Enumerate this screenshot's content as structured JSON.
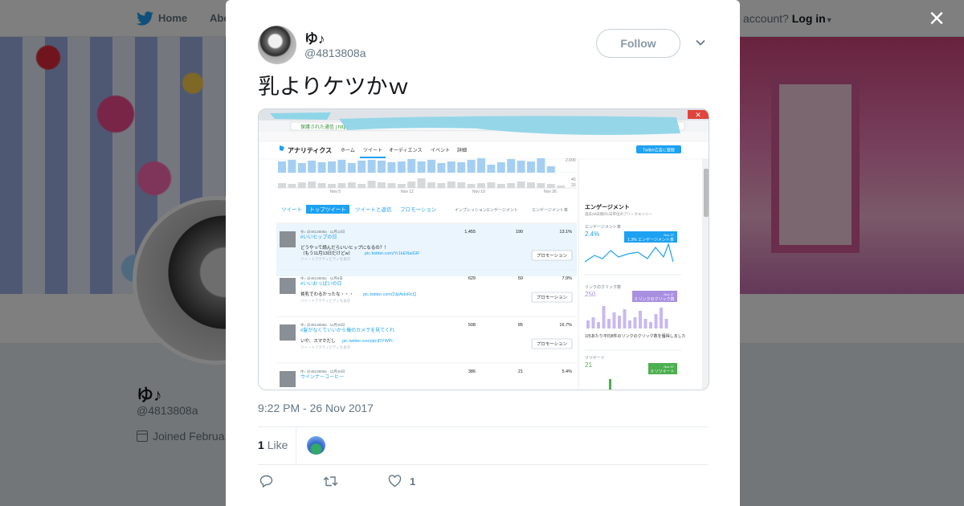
{
  "background": {
    "nav": {
      "home": "Home",
      "about": "Abo"
    },
    "login": {
      "prompt": "account?",
      "link": "Log in"
    },
    "profile": {
      "name": "ゆ♪",
      "handle": "@4813808a",
      "joined": "Joined Februa"
    }
  },
  "modal": {
    "close_label": "×",
    "author": {
      "name": "ゆ♪",
      "handle": "@4813808a"
    },
    "follow_label": "Follow",
    "text": "乳よりケツかｗ",
    "timestamp": "9:22 PM - 26 Nov 2017",
    "likes": {
      "count": "1",
      "label": "Like"
    },
    "actions": {
      "like_count": "1"
    }
  },
  "screenshot": {
    "address": "保護された通信 | https",
    "brand": "アナリティクス",
    "nav": [
      "ホーム",
      "ツイート",
      "オーディエンス",
      "イベント",
      "詳細"
    ],
    "ads_button": "Twitter広告に登録",
    "axis": [
      "Nov 5",
      "Nov 12",
      "Nov 19",
      "Nov 26"
    ],
    "axis_right": [
      "2,000",
      "40",
      "20"
    ],
    "tabs": [
      "ツイート",
      "トップツイート",
      "ツイートと返信",
      "プロモーション"
    ],
    "cols": [
      "インプレッション",
      "エンゲージメント",
      "エンゲージメント率"
    ],
    "tweets": [
      {
        "meta": "ゆ♪ @4813808a · 11月12日",
        "title": "#いいヒップの日",
        "body": "どうやって読んだらいいヒップになるの？！",
        "body2": "（もう11月13日だけどw）",
        "link": "pic.twitter.com/Yr1kENaiGR",
        "activity": "ツイートアクティビティを表示",
        "imp": "1,455",
        "eng": "190",
        "rate": "13.1%"
      },
      {
        "meta": "ゆ♪ @4813808a · 11月8日",
        "title": "#いいおっぱいの日",
        "body": "貧乳でわるかったな・・・",
        "link": "pic.twitter.com/2JpAdoRcQ",
        "activity": "ツイートアクティビティを表示",
        "imp": "629",
        "eng": "50",
        "rate": "7.9%"
      },
      {
        "meta": "ゆ♪ @4813808a · 11月25日",
        "title": "#髪がなくていいから俺のカメラを見てくれ",
        "body": "いや、スマホだし",
        "link": "pic.twitter.com/qlcIDYWPi",
        "activity": "ツイートアクティビティを表示",
        "imp": "508",
        "eng": "85",
        "rate": "16.7%"
      },
      {
        "meta": "ゆ♪ @4813808a · 11月26日",
        "title": "ウインナーコーヒー",
        "imp": "386",
        "eng": "21",
        "rate": "5.4%"
      }
    ],
    "promo_label": "プロモーション",
    "side": {
      "title": "エンゲージメント",
      "subtitle": "過去28日間の1日単位のフリークエンシー",
      "rate_label": "エンゲージメント率",
      "rate_value": "2.4%",
      "rate_badge": "1.3% エンゲージメント率",
      "link_label": "リンクのクリック数",
      "link_value": "250",
      "link_badge": "0 リンクのクリック数",
      "link_note": "1日あたり平均8件のリンクのクリック数を獲得しました",
      "rt_label": "リツイート",
      "rt_value": "21",
      "rt_badge": "0 リツイート",
      "badge_date": "Nov 27"
    }
  },
  "colors": {
    "twitter_blue": "#1da1f2",
    "text_primary": "#14171a",
    "text_secondary": "#657786",
    "chart_bar": "#a5cff2",
    "chart_purple": "#a98fe0",
    "chart_green": "#4caf50",
    "redaction": "#8fd5e8"
  }
}
